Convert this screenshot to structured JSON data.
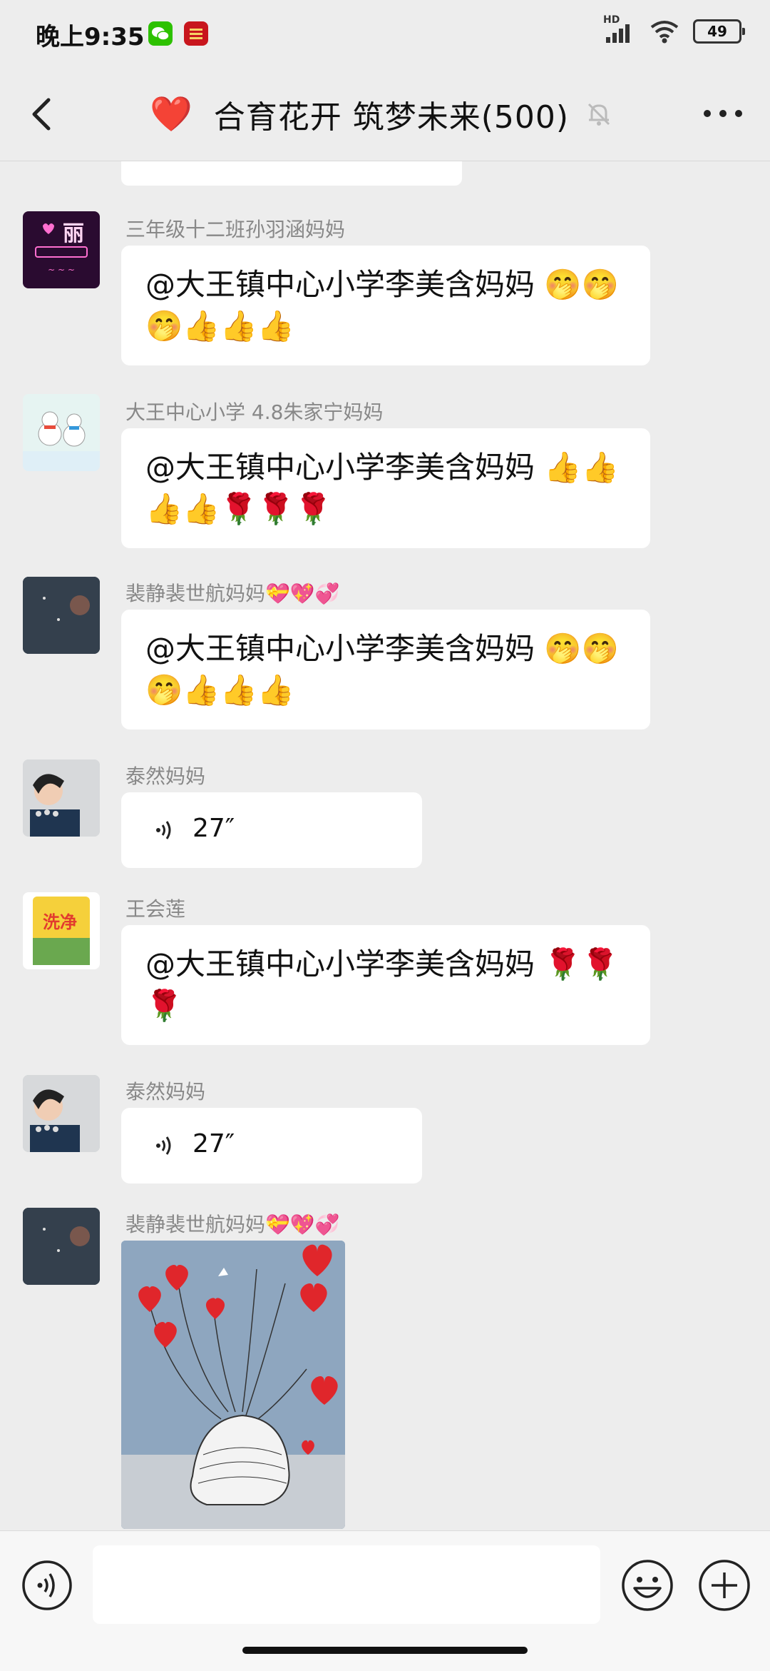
{
  "status_bar": {
    "time": "晚上9:35",
    "network_label": "HD",
    "battery": "49",
    "app_icons": [
      "wechat-icon",
      "study-app-icon"
    ]
  },
  "header": {
    "title_emoji": "❤️",
    "title": "合育花开 筑梦未来(500)",
    "icons": [
      "back-arrow-icon",
      "mute-bell-icon",
      "more-dots-icon"
    ]
  },
  "messages": [
    {
      "type": "text",
      "sender": "三年级十二班孙羽涵妈妈",
      "avatar_text": "丽",
      "text": "@大王镇中心小学李美含妈妈 🤭🤭🤭👍👍👍"
    },
    {
      "type": "text",
      "sender": "大王中心小学 4.8朱家宁妈妈",
      "text": "@大王镇中心小学李美含妈妈 👍👍👍👍🌹🌹🌹"
    },
    {
      "type": "text",
      "sender": "裴静裴世航妈妈💝💖💞",
      "text": "@大王镇中心小学李美含妈妈 🤭🤭🤭👍👍👍"
    },
    {
      "type": "voice",
      "sender": "泰然妈妈",
      "duration": "27″"
    },
    {
      "type": "text",
      "sender": "王会莲",
      "avatar_text": "洗净",
      "text": "@大王镇中心小学李美含妈妈 🌹🌹🌹"
    },
    {
      "type": "voice",
      "sender": "泰然妈妈",
      "duration": "27″"
    },
    {
      "type": "image",
      "sender": "裴静裴世航妈妈💝💖💞"
    }
  ],
  "input_bar": {
    "icons": [
      "voice-input-icon",
      "emoji-icon",
      "plus-icon"
    ]
  },
  "colors": {
    "background": "#ededed",
    "bubble": "#ffffff",
    "sender_text": "#888888",
    "heart": "#d91e18"
  }
}
